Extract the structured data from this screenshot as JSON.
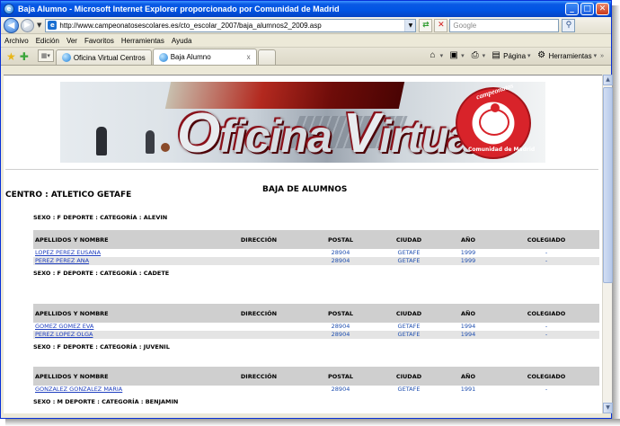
{
  "window": {
    "title": "Baja Alumno - Microsoft Internet Explorer proporcionado por Comunidad de Madrid",
    "minimize": "_",
    "maximize": "□",
    "close": "✕"
  },
  "address": {
    "url": "http://www.campeonatosescolares.es/cto_escolar_2007/baja_alumnos2_2009.asp",
    "search_placeholder": "Google"
  },
  "menu": [
    "Archivo",
    "Edición",
    "Ver",
    "Favoritos",
    "Herramientas",
    "Ayuda"
  ],
  "tabs": [
    {
      "label": "Oficina Virtual Centros"
    },
    {
      "label": "Baja Alumno",
      "close": "x"
    }
  ],
  "toolbar": {
    "page_label": "Página",
    "tools_label": "Herramientas"
  },
  "banner": {
    "first_cap": "O",
    "first_rest": "ficina",
    "second_cap": "V",
    "second_rest": "irtual",
    "seal_top": "campeonatos",
    "seal_bottom": "Comunidad de Madrid"
  },
  "page": {
    "heading": "BAJA DE ALUMNOS",
    "centro": "CENTRO : ATLETICO GETAFE"
  },
  "table_headers": {
    "name": "APELLIDOS Y NOMBRE",
    "direccion": "DIRECCIÓN",
    "postal": "POSTAL",
    "ciudad": "CIUDAD",
    "ano": "AÑO",
    "colegiado": "COLEGIADO"
  },
  "groups": [
    {
      "label": "SEXO : F  DEPORTE :  CATEGORÍA : ALEVIN",
      "rows": [
        {
          "name": "LOPEZ PEREZ EUSANA",
          "direccion": "",
          "postal": "28904",
          "ciudad": "GETAFE",
          "ano": "1999",
          "colegiado": "-"
        },
        {
          "name": "PEREZ PEREZ ANA",
          "direccion": "",
          "postal": "28904",
          "ciudad": "GETAFE",
          "ano": "1999",
          "colegiado": "-"
        }
      ]
    },
    {
      "label": "SEXO : F  DEPORTE :  CATEGORÍA : CADETE",
      "rows": [
        {
          "name": "GOMEZ GOMEZ EVA",
          "direccion": "",
          "postal": "28904",
          "ciudad": "GETAFE",
          "ano": "1994",
          "colegiado": "-"
        },
        {
          "name": "PEREZ LOPEZ OLGA",
          "direccion": "",
          "postal": "28904",
          "ciudad": "GETAFE",
          "ano": "1994",
          "colegiado": "-"
        }
      ]
    },
    {
      "label": "SEXO : F  DEPORTE :  CATEGORÍA : JUVENIL",
      "rows": [
        {
          "name": "GONZALEZ GONZALEZ MARIA",
          "direccion": "",
          "postal": "28904",
          "ciudad": "GETAFE",
          "ano": "1991",
          "colegiado": "-"
        }
      ]
    },
    {
      "label": "SEXO : M  DEPORTE :  CATEGORÍA : BENJAMIN",
      "rows": []
    }
  ]
}
